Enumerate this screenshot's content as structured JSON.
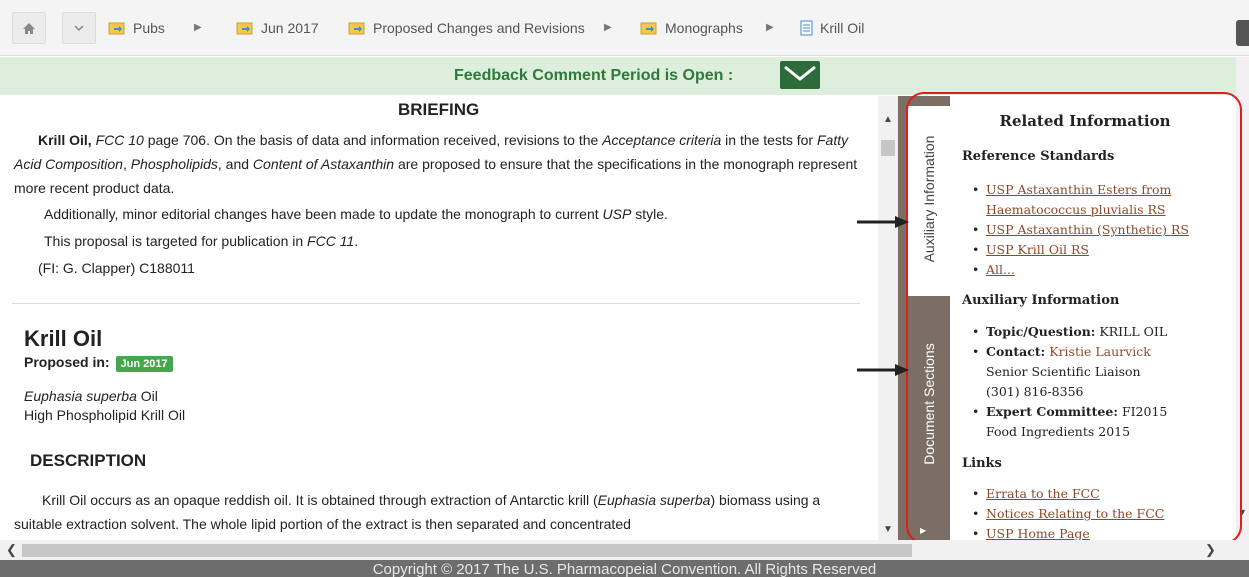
{
  "breadcrumbs": [
    "Pubs",
    "Jun 2017",
    "Proposed Changes and Revisions",
    "Monographs",
    "Krill Oil"
  ],
  "feedback": {
    "text": "Feedback Comment Period is Open :"
  },
  "briefing": {
    "heading": "BRIEFING",
    "p1_name": "Krill Oil,",
    "p1_a": "FCC 10",
    "p1_b": " page 706. On the basis of data and information received, revisions to the ",
    "p1_c": "Acceptance criteria",
    "p1_d": " in the tests for ",
    "p1_e": "Fatty Acid Composition",
    "p1_f": ", ",
    "p1_g": "Phospholipids",
    "p1_h": ", and ",
    "p1_i": "Content of Astaxanthin",
    "p1_j": " are proposed to ensure that the specifications in the monograph represent more recent product data.",
    "p2_a": "Additionally, minor editorial changes have been made to update the monograph to current ",
    "p2_b": "USP",
    "p2_c": " style.",
    "p3_a": "This proposal is targeted for publication in ",
    "p3_b": "FCC 11",
    "p3_c": ".",
    "p4": "(FI: G. Clapper) C188011"
  },
  "monograph": {
    "title": "Krill Oil",
    "proposed_label": "Proposed in:",
    "proposed_badge": "Jun 2017",
    "alt1_a": "Euphasia superba",
    "alt1_b": " Oil",
    "alt2": "High Phospholipid Krill Oil",
    "description_heading": "DESCRIPTION",
    "desc_a": "Krill Oil occurs as an opaque reddish oil. It is obtained through extraction of Antarctic krill (",
    "desc_b": "Euphasia superba",
    "desc_c": ") biomass using a suitable extraction solvent. The whole lipid portion of the extract is then separated and concentrated"
  },
  "tabs": {
    "auxiliary": "Auxiliary Information",
    "document": "Document Sections"
  },
  "related": {
    "title": "Related Information",
    "reference_heading": "Reference Standards",
    "reference_items": [
      "USP Astaxanthin Esters from Haematococcus pluvialis RS",
      "USP Astaxanthin (Synthetic) RS",
      "USP Krill Oil RS",
      "All..."
    ],
    "aux_heading": "Auxiliary Information",
    "topic_label": "Topic/Question:",
    "topic_value": "KRILL OIL",
    "contact_label": "Contact:",
    "contact_name": "Kristie Laurvick",
    "contact_title": "Senior Scientific Liaison",
    "contact_phone": "(301) 816-8356",
    "committee_label": "Expert Committee:",
    "committee_value": "FI2015",
    "committee_value2": "Food Ingredients 2015",
    "links_heading": "Links",
    "links": [
      "Errata to the FCC",
      "Notices Relating to the FCC",
      "USP Home Page"
    ]
  },
  "footer": {
    "text": "Copyright © 2017 The U.S. Pharmacopeial Convention. All Rights Reserved"
  }
}
